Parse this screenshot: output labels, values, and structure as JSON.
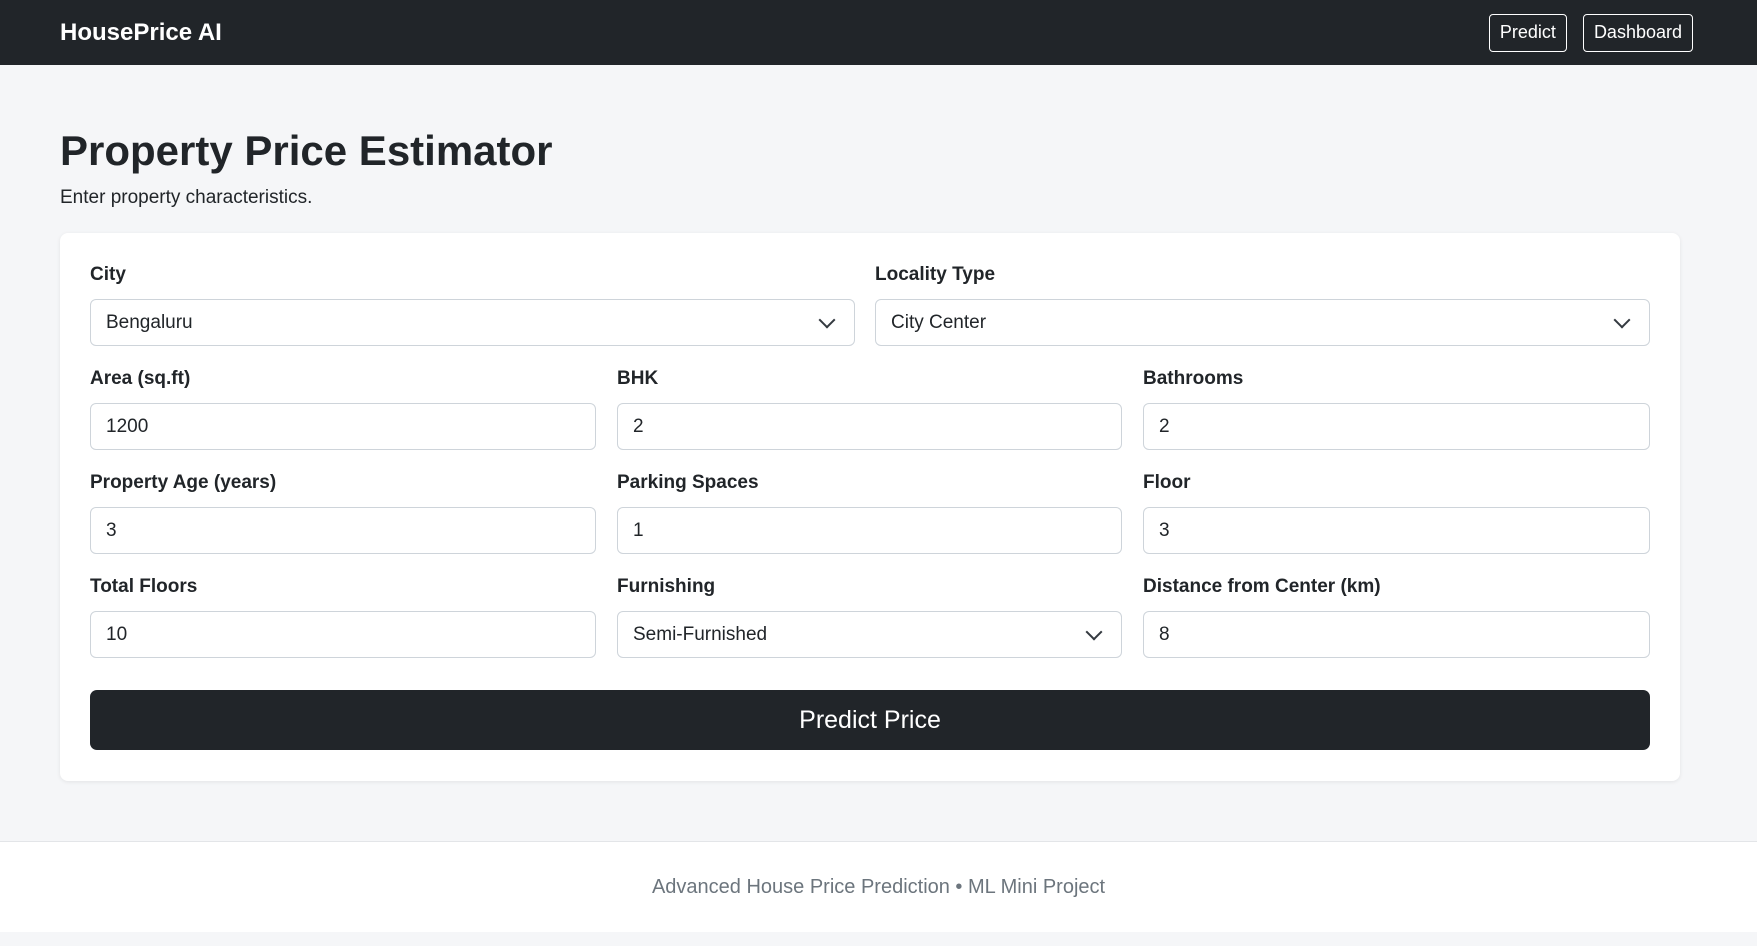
{
  "navbar": {
    "brand": "HousePrice AI",
    "buttons": [
      "Predict",
      "Dashboard"
    ]
  },
  "page": {
    "title": "Property Price Estimator",
    "subtitle": "Enter property characteristics."
  },
  "form": {
    "city": {
      "label": "City",
      "value": "Bengaluru"
    },
    "locality_type": {
      "label": "Locality Type",
      "value": "City Center"
    },
    "area": {
      "label": "Area (sq.ft)",
      "value": "1200"
    },
    "bhk": {
      "label": "BHK",
      "value": "2"
    },
    "bathrooms": {
      "label": "Bathrooms",
      "value": "2"
    },
    "property_age": {
      "label": "Property Age (years)",
      "value": "3"
    },
    "parking_spaces": {
      "label": "Parking Spaces",
      "value": "1"
    },
    "floor": {
      "label": "Floor",
      "value": "3"
    },
    "total_floors": {
      "label": "Total Floors",
      "value": "10"
    },
    "furnishing": {
      "label": "Furnishing",
      "value": "Semi-Furnished"
    },
    "distance_from_center": {
      "label": "Distance from Center (km)",
      "value": "8"
    },
    "submit_label": "Predict Price"
  },
  "footer": {
    "text": "Advanced House Price Prediction • ML Mini Project"
  },
  "colors": {
    "navbar_bg": "#212529",
    "page_bg": "#f5f6f8",
    "card_bg": "#ffffff",
    "footer_text": "#6c757d"
  }
}
